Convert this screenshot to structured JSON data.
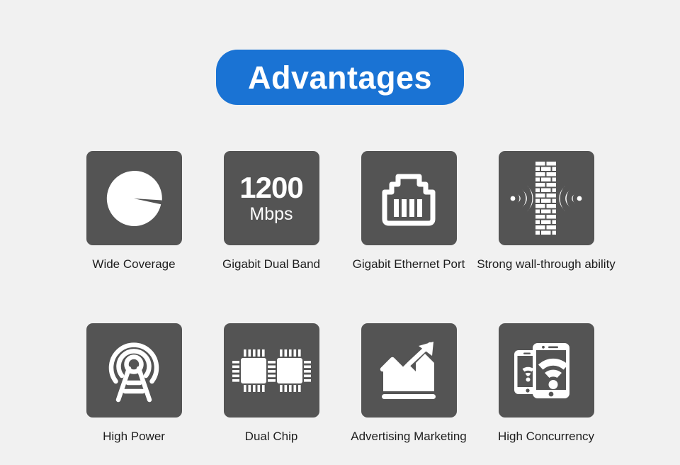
{
  "banner": {
    "title": "Advantages",
    "background_color": "#1a73d4",
    "text_color": "#ffffff"
  },
  "page": {
    "background_color": "#f1f1f1",
    "tile_color": "#545454",
    "icon_color": "#ffffff",
    "label_color": "#1e1e1e"
  },
  "rows": [
    {
      "cells": [
        {
          "label": "Wide Coverage",
          "icon": "pie-coverage-icon"
        },
        {
          "label": "Gigabit Dual Band",
          "icon": "speed-1200-mbps-icon",
          "speed_value": "1200",
          "speed_unit": "Mbps"
        },
        {
          "label": "Gigabit Ethernet Port",
          "icon": "rj45-ethernet-port-icon"
        },
        {
          "label": "Strong wall-through ability",
          "icon": "brick-wall-signal-icon"
        }
      ]
    },
    {
      "cells": [
        {
          "label": "High Power",
          "icon": "antenna-tower-icon"
        },
        {
          "label": "Dual Chip",
          "icon": "dual-chip-icon"
        },
        {
          "label": "Advertising Marketing",
          "icon": "growth-chart-arrow-icon"
        },
        {
          "label": "High Concurrency",
          "icon": "phones-wifi-icon"
        }
      ]
    }
  ]
}
